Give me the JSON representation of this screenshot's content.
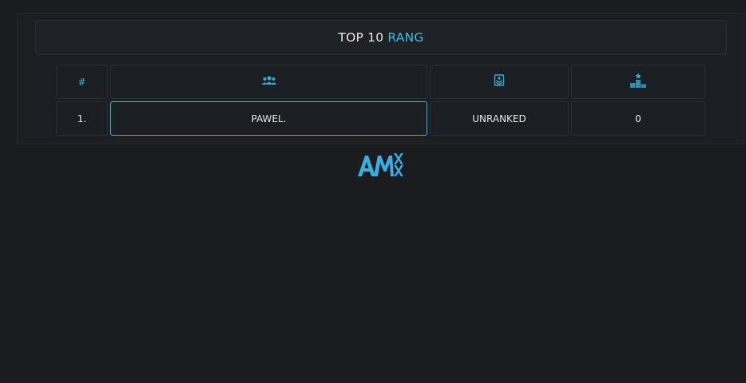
{
  "header": {
    "title_prefix": "TOP 10",
    "title_accent": "RANG"
  },
  "table": {
    "columns": [
      {
        "label": "#",
        "icon": null
      },
      {
        "label": "",
        "icon": "players-icon"
      },
      {
        "label": "",
        "icon": "rank-badge-icon"
      },
      {
        "label": "",
        "icon": "podium-icon"
      }
    ],
    "rows": [
      {
        "position": "1.",
        "name": "PAWEL.",
        "rank": "UNRANKED",
        "points": "0"
      }
    ]
  },
  "footer": {
    "logo_text": "AMX",
    "logo_icon": "amx-logo-icon"
  },
  "colors": {
    "background": "#1a1c20",
    "accent": "#3ec0e0",
    "border": "#2b2f35",
    "highlight_border": "#35b8d6"
  }
}
